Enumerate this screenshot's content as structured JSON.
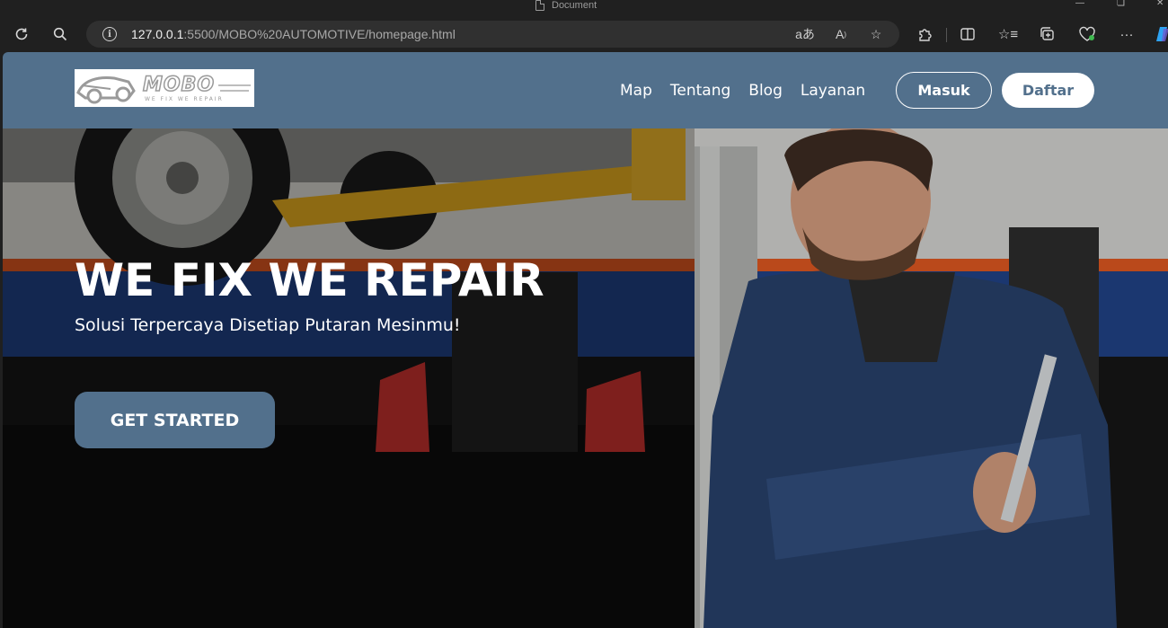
{
  "window": {
    "title": "Document"
  },
  "browser": {
    "url_host": "127.0.0.1",
    "url_path": ":5500/MOBO%20AUTOMOTIVE/homepage.html",
    "icons": [
      "refresh-icon",
      "search-icon",
      "info-icon",
      "translate-icon",
      "read-aloud-icon",
      "favorite-star-icon",
      "extensions-icon",
      "split-screen-icon",
      "favorites-list-icon",
      "collections-icon",
      "browser-essentials-icon",
      "more-icon",
      "copilot-icon"
    ]
  },
  "site": {
    "logo": {
      "word": "MOBO",
      "tagline": "WE FIX WE REPAIR"
    },
    "menu": [
      {
        "label": "Map"
      },
      {
        "label": "Tentang"
      },
      {
        "label": "Blog"
      },
      {
        "label": "Layanan"
      }
    ],
    "login_label": "Masuk",
    "register_label": "Daftar",
    "brand_color": "#52708c"
  },
  "hero": {
    "title": "WE FIX WE REPAIR",
    "subtitle": "Solusi Terpercaya Disetiap Putaran Mesinmu!",
    "cta_label": "GET STARTED"
  }
}
